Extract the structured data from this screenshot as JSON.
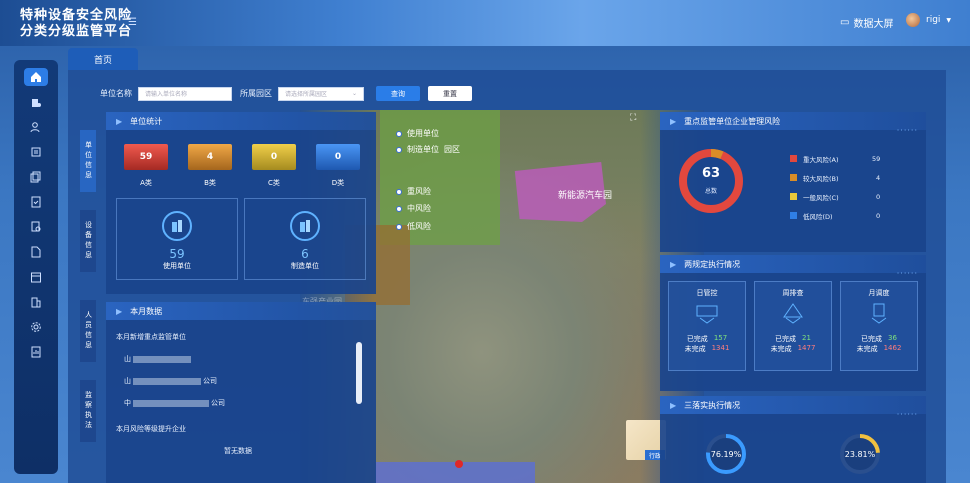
{
  "header": {
    "title_line1": "特种设备安全风险",
    "title_line2": "分类分级监管平台",
    "big_screen_label": "数据大屏",
    "username": "rigi"
  },
  "tab": {
    "label": "首页"
  },
  "search": {
    "unit_name_label": "单位名称",
    "unit_name_placeholder": "请输入单位名称",
    "park_label": "所属园区",
    "park_placeholder": "请选择所属园区",
    "query_label": "查询",
    "reset_label": "重置"
  },
  "side_labels": {
    "unit_info": "单位信息",
    "equipment_info": "设备信息",
    "staff_info": "人员信息",
    "supervision": "监察执法"
  },
  "unit_stats": {
    "title": "单位统计",
    "categories": [
      {
        "label": "A类",
        "value": "59",
        "color": "#e2483e"
      },
      {
        "label": "B类",
        "value": "4",
        "color": "#d98d28"
      },
      {
        "label": "C类",
        "value": "0",
        "color": "#d9b92a"
      },
      {
        "label": "D类",
        "value": "0",
        "color": "#2f7fe6"
      }
    ],
    "use_units": {
      "value": "59",
      "label": "使用单位"
    },
    "manufacturing_units": {
      "value": "6",
      "label": "制造单位"
    }
  },
  "monthly": {
    "title": "本月数据",
    "new_units_title": "本月新增重点监管单位",
    "items": [
      "山",
      "山",
      "中"
    ],
    "items_suffix": [
      "",
      "公司",
      "公司"
    ],
    "risk_up_title": "本月风险等级提升企业",
    "no_data": "暂无数据"
  },
  "map": {
    "legend_park": "使用单位",
    "legend_manu": "制造单位",
    "park_mark": "园区",
    "risk_major": "重风险",
    "risk_mid": "中风险",
    "risk_low": "低风险",
    "park_name": "新能源汽车园",
    "mini_label": "行政",
    "watermark": "东强产业园"
  },
  "risk_panel": {
    "title": "重点监管单位企业管理风险",
    "total": "63",
    "total_label": "总数",
    "levels": [
      {
        "label": "重大风险(A)",
        "value": "59",
        "color": "#e2483e"
      },
      {
        "label": "较大风险(B)",
        "value": "4",
        "color": "#d98d28"
      },
      {
        "label": "一般风险(C)",
        "value": "0",
        "color": "#e8c83a"
      },
      {
        "label": "低风险(D)",
        "value": "0",
        "color": "#2f7fe6"
      }
    ]
  },
  "two_rules": {
    "title": "两规定执行情况",
    "cards": [
      {
        "title": "日管控",
        "done_label": "已完成",
        "done": "157",
        "undone_label": "未完成",
        "undone": "1341"
      },
      {
        "title": "周排查",
        "done_label": "已完成",
        "done": "21",
        "undone_label": "未完成",
        "undone": "1477"
      },
      {
        "title": "月调度",
        "done_label": "已完成",
        "done": "36",
        "undone_label": "未完成",
        "undone": "1462"
      }
    ]
  },
  "three_impl": {
    "title": "三落实执行情况",
    "rates": [
      {
        "value": "76.19%",
        "fraction": 0.7619,
        "color": "#3a9bff"
      },
      {
        "value": "23.81%",
        "fraction": 0.2381,
        "color": "#f0c040"
      }
    ]
  },
  "more_dots": "······"
}
